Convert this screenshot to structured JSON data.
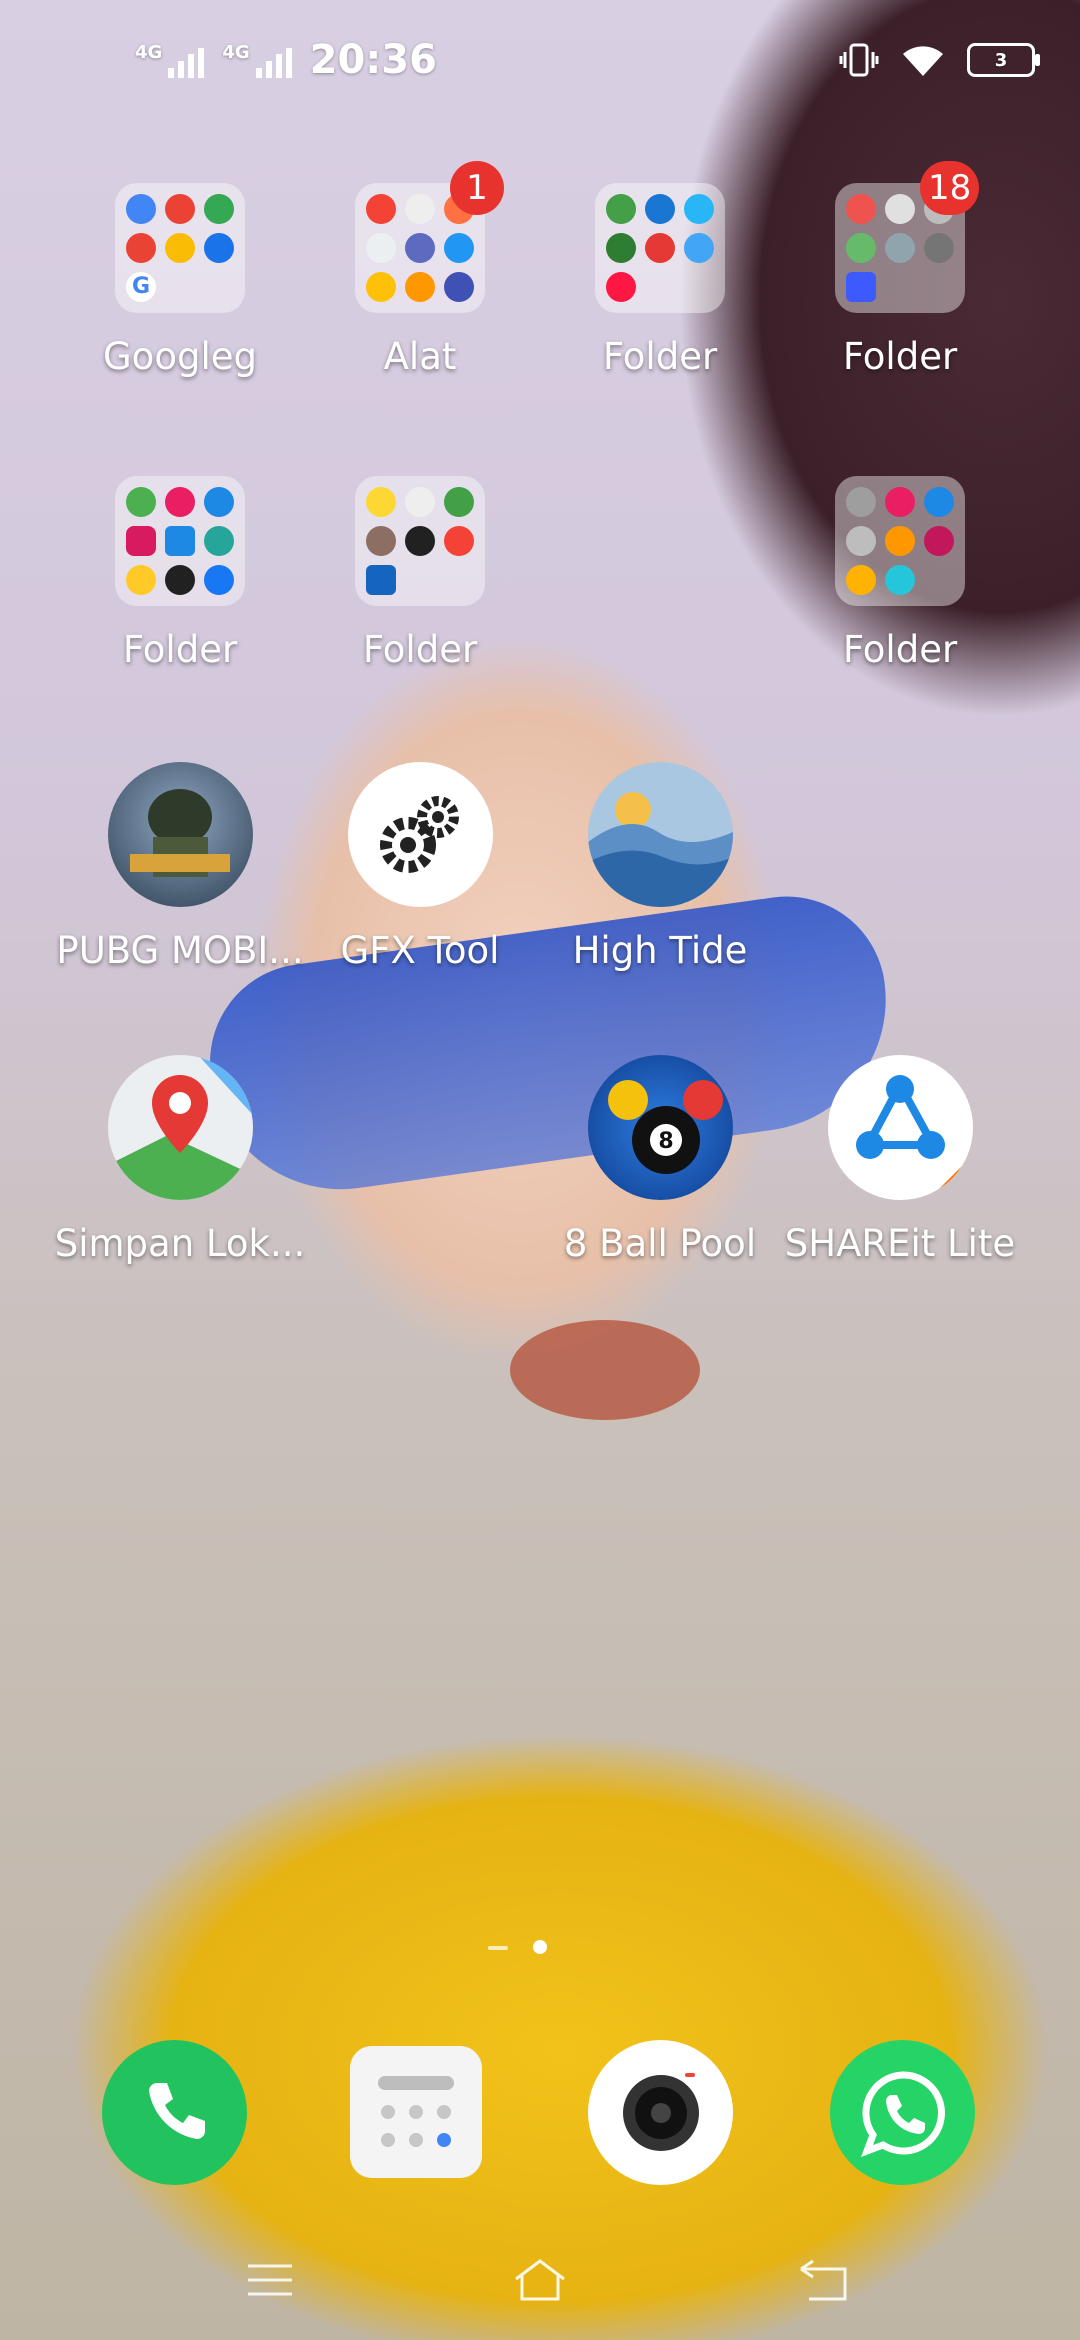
{
  "status_bar": {
    "sim1": "4G",
    "sim2": "4G",
    "time": "20:36",
    "battery": "3"
  },
  "home": {
    "folders": [
      {
        "label": "Googleg",
        "badge": "",
        "apps": [
          "#4285f4",
          "#ea4335",
          "#34a853",
          "#ea4335",
          "#fbbc05",
          "#1a73e8",
          "#4285f4"
        ]
      },
      {
        "label": "Alat",
        "badge": "1",
        "apps": [
          "#f44336",
          "#9e9e9e",
          "#ff7043",
          "#cfd8dc",
          "#5c6bc0",
          "#2196f3",
          "#ffc107",
          "#ff9800",
          "#3f51b5"
        ]
      },
      {
        "label": "Folder",
        "badge": "",
        "apps": [
          "#43a047",
          "#1976d2",
          "#29b6f6",
          "#2e7d32",
          "#e53935",
          "#42a5f5",
          "#ff1744"
        ]
      },
      {
        "label": "Folder",
        "badge": "18",
        "apps": [
          "#ef5350",
          "#bdbdbd",
          "#e0e0e0",
          "#66bb6a",
          "#90a4ae",
          "#757575",
          "#3d5afe"
        ]
      },
      {
        "label": "Folder",
        "badge": "",
        "apps": [
          "#4caf50",
          "#e91e63",
          "#1e88e5",
          "#d81b60",
          "#1e88e5",
          "#26a69a",
          "#ffca28",
          "#212121",
          "#1877f2"
        ]
      },
      {
        "label": "Folder",
        "badge": "",
        "apps": [
          "#fdd835",
          "#eeeeee",
          "#43a047",
          "#8d6e63",
          "#212121",
          "#f44336",
          "#1565c0"
        ]
      },
      {
        "label": "Folder",
        "badge": "",
        "apps": [
          "#9e9e9e",
          "#e91e63",
          "#1e88e5",
          "#bdbdbd",
          "#ff9800",
          "#c2185b",
          "#ffb300",
          "#26c6da"
        ]
      }
    ],
    "apps": [
      {
        "label": "PUBG MOBI...",
        "icon": "pubg-icon"
      },
      {
        "label": "GFX Tool",
        "icon": "gear-icon"
      },
      {
        "label": "High Tide",
        "icon": "wave-icon"
      },
      {
        "label": "Simpan Lok...",
        "icon": "map-pin-icon"
      },
      {
        "label": "8 Ball Pool",
        "icon": "billiard-ball-icon"
      },
      {
        "label": "SHAREit Lite",
        "icon": "shareit-icon"
      }
    ]
  },
  "dock": [
    "phone-icon",
    "calculator-icon",
    "camera-icon",
    "whatsapp-icon"
  ],
  "colors": {
    "badge": "#e8322e",
    "phone": "#22c35e",
    "whatsapp": "#25d366",
    "shareit": "#1e88e5"
  }
}
